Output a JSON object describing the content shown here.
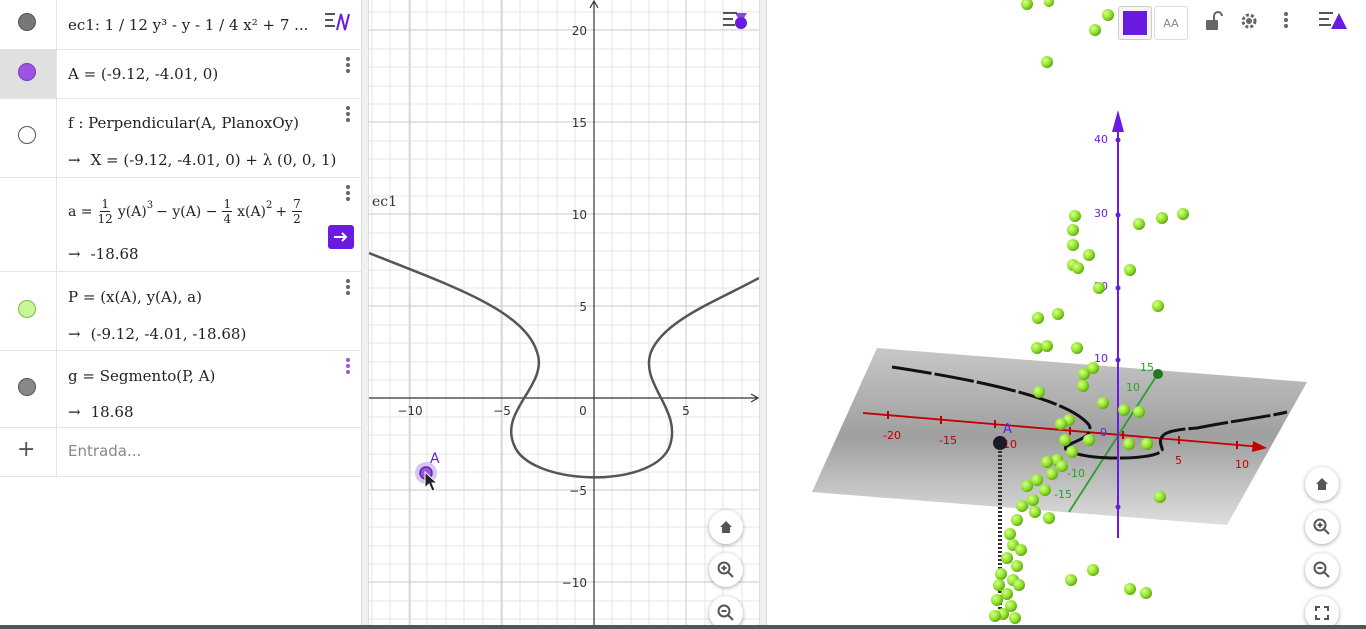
{
  "colors": {
    "accent": "#6a1be0",
    "purple_marble": "#9b55e0",
    "green_point": "#8fe22a",
    "curve": "#444444",
    "x_axis_3d": "#c00000",
    "y_axis_3d": "#2aa02a",
    "z_axis_3d": "#6a1be0"
  },
  "algebra": {
    "row_ec1": {
      "text": "ec1: 1 / 12 y³ - y - 1 / 4 x² + 7 ..."
    },
    "row_A": {
      "text": "A = (-9.12, -4.01, 0)"
    },
    "row_f": {
      "def": "f : Perpendicular(A, PlanoxOy)",
      "out": "X = (-9.12, -4.01, 0) + λ (0, 0, 1)"
    },
    "row_a": {
      "lhs": "a =",
      "f1n": "1",
      "f1d": "12",
      "mid1": "y(A)",
      "exp1": "3",
      "mid2": " − y(A) −",
      "f2n": "1",
      "f2d": "4",
      "mid3": "x(A)",
      "exp2": "2",
      "mid4": " +",
      "f3n": "7",
      "f3d": "2",
      "out": "-18.68"
    },
    "row_P": {
      "def": "P = (x(A), y(A), a)",
      "out": "(-9.12, -4.01, -18.68)"
    },
    "row_g": {
      "def": "g = Segmento(P, A)",
      "out": "18.68"
    },
    "input": {
      "placeholder": "Entrada...",
      "plus": "+"
    },
    "arrow": "→"
  },
  "graphics2d": {
    "x_ticks": [
      "−10",
      "−5",
      "0",
      "5"
    ],
    "y_ticks": [
      "20",
      "15",
      "10",
      "5",
      "−5",
      "−10"
    ],
    "curve_label": "ec1",
    "point_label": "A"
  },
  "graphics3d": {
    "x_ticks": [
      "-20",
      "-15",
      "10",
      "5",
      "10"
    ],
    "z_ticks": [
      "40",
      "30",
      "20",
      "10",
      "0"
    ],
    "y_ticks": [
      "15",
      "10",
      "-10",
      "-15"
    ],
    "point_label": "A",
    "toolbar": {
      "text_size": "AA"
    }
  }
}
